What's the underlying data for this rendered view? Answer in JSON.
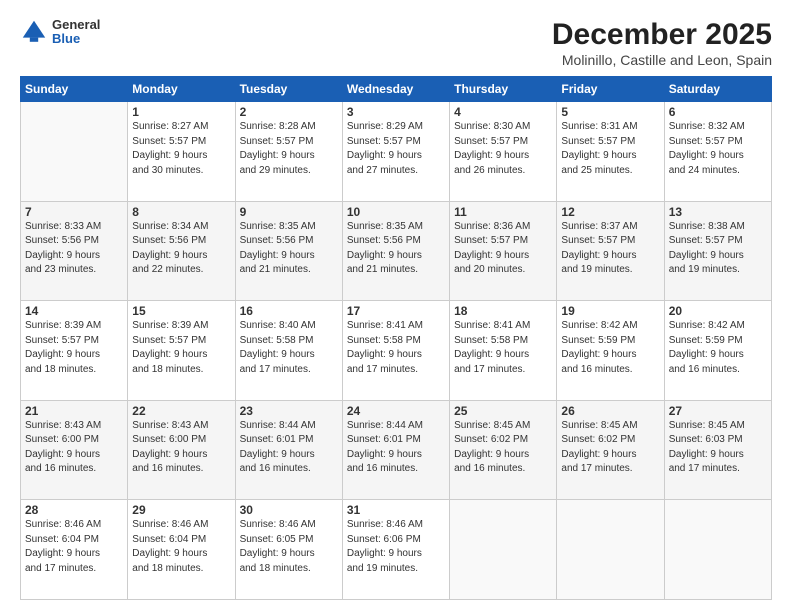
{
  "logo": {
    "general": "General",
    "blue": "Blue"
  },
  "title": "December 2025",
  "subtitle": "Molinillo, Castille and Leon, Spain",
  "header_days": [
    "Sunday",
    "Monday",
    "Tuesday",
    "Wednesday",
    "Thursday",
    "Friday",
    "Saturday"
  ],
  "weeks": [
    [
      {
        "day": "",
        "info": ""
      },
      {
        "day": "1",
        "info": "Sunrise: 8:27 AM\nSunset: 5:57 PM\nDaylight: 9 hours\nand 30 minutes."
      },
      {
        "day": "2",
        "info": "Sunrise: 8:28 AM\nSunset: 5:57 PM\nDaylight: 9 hours\nand 29 minutes."
      },
      {
        "day": "3",
        "info": "Sunrise: 8:29 AM\nSunset: 5:57 PM\nDaylight: 9 hours\nand 27 minutes."
      },
      {
        "day": "4",
        "info": "Sunrise: 8:30 AM\nSunset: 5:57 PM\nDaylight: 9 hours\nand 26 minutes."
      },
      {
        "day": "5",
        "info": "Sunrise: 8:31 AM\nSunset: 5:57 PM\nDaylight: 9 hours\nand 25 minutes."
      },
      {
        "day": "6",
        "info": "Sunrise: 8:32 AM\nSunset: 5:57 PM\nDaylight: 9 hours\nand 24 minutes."
      }
    ],
    [
      {
        "day": "7",
        "info": "Sunrise: 8:33 AM\nSunset: 5:56 PM\nDaylight: 9 hours\nand 23 minutes."
      },
      {
        "day": "8",
        "info": "Sunrise: 8:34 AM\nSunset: 5:56 PM\nDaylight: 9 hours\nand 22 minutes."
      },
      {
        "day": "9",
        "info": "Sunrise: 8:35 AM\nSunset: 5:56 PM\nDaylight: 9 hours\nand 21 minutes."
      },
      {
        "day": "10",
        "info": "Sunrise: 8:35 AM\nSunset: 5:56 PM\nDaylight: 9 hours\nand 21 minutes."
      },
      {
        "day": "11",
        "info": "Sunrise: 8:36 AM\nSunset: 5:57 PM\nDaylight: 9 hours\nand 20 minutes."
      },
      {
        "day": "12",
        "info": "Sunrise: 8:37 AM\nSunset: 5:57 PM\nDaylight: 9 hours\nand 19 minutes."
      },
      {
        "day": "13",
        "info": "Sunrise: 8:38 AM\nSunset: 5:57 PM\nDaylight: 9 hours\nand 19 minutes."
      }
    ],
    [
      {
        "day": "14",
        "info": "Sunrise: 8:39 AM\nSunset: 5:57 PM\nDaylight: 9 hours\nand 18 minutes."
      },
      {
        "day": "15",
        "info": "Sunrise: 8:39 AM\nSunset: 5:57 PM\nDaylight: 9 hours\nand 18 minutes."
      },
      {
        "day": "16",
        "info": "Sunrise: 8:40 AM\nSunset: 5:58 PM\nDaylight: 9 hours\nand 17 minutes."
      },
      {
        "day": "17",
        "info": "Sunrise: 8:41 AM\nSunset: 5:58 PM\nDaylight: 9 hours\nand 17 minutes."
      },
      {
        "day": "18",
        "info": "Sunrise: 8:41 AM\nSunset: 5:58 PM\nDaylight: 9 hours\nand 17 minutes."
      },
      {
        "day": "19",
        "info": "Sunrise: 8:42 AM\nSunset: 5:59 PM\nDaylight: 9 hours\nand 16 minutes."
      },
      {
        "day": "20",
        "info": "Sunrise: 8:42 AM\nSunset: 5:59 PM\nDaylight: 9 hours\nand 16 minutes."
      }
    ],
    [
      {
        "day": "21",
        "info": "Sunrise: 8:43 AM\nSunset: 6:00 PM\nDaylight: 9 hours\nand 16 minutes."
      },
      {
        "day": "22",
        "info": "Sunrise: 8:43 AM\nSunset: 6:00 PM\nDaylight: 9 hours\nand 16 minutes."
      },
      {
        "day": "23",
        "info": "Sunrise: 8:44 AM\nSunset: 6:01 PM\nDaylight: 9 hours\nand 16 minutes."
      },
      {
        "day": "24",
        "info": "Sunrise: 8:44 AM\nSunset: 6:01 PM\nDaylight: 9 hours\nand 16 minutes."
      },
      {
        "day": "25",
        "info": "Sunrise: 8:45 AM\nSunset: 6:02 PM\nDaylight: 9 hours\nand 16 minutes."
      },
      {
        "day": "26",
        "info": "Sunrise: 8:45 AM\nSunset: 6:02 PM\nDaylight: 9 hours\nand 17 minutes."
      },
      {
        "day": "27",
        "info": "Sunrise: 8:45 AM\nSunset: 6:03 PM\nDaylight: 9 hours\nand 17 minutes."
      }
    ],
    [
      {
        "day": "28",
        "info": "Sunrise: 8:46 AM\nSunset: 6:04 PM\nDaylight: 9 hours\nand 17 minutes."
      },
      {
        "day": "29",
        "info": "Sunrise: 8:46 AM\nSunset: 6:04 PM\nDaylight: 9 hours\nand 18 minutes."
      },
      {
        "day": "30",
        "info": "Sunrise: 8:46 AM\nSunset: 6:05 PM\nDaylight: 9 hours\nand 18 minutes."
      },
      {
        "day": "31",
        "info": "Sunrise: 8:46 AM\nSunset: 6:06 PM\nDaylight: 9 hours\nand 19 minutes."
      },
      {
        "day": "",
        "info": ""
      },
      {
        "day": "",
        "info": ""
      },
      {
        "day": "",
        "info": ""
      }
    ]
  ]
}
